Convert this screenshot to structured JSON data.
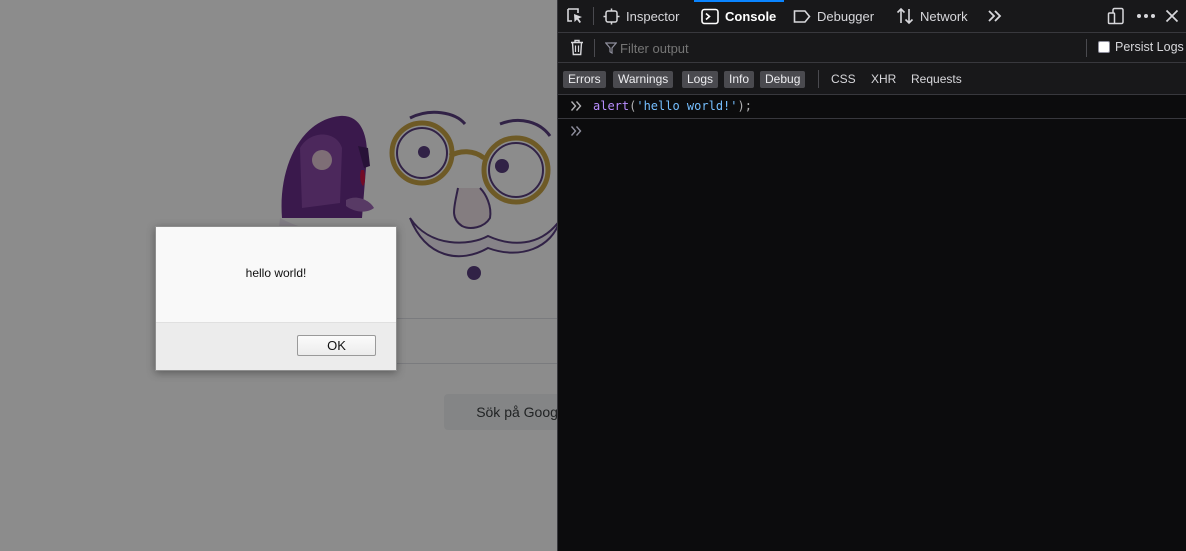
{
  "page": {
    "search_button_label": "Sök på Google"
  },
  "alert": {
    "message": "hello world!",
    "ok_label": "OK"
  },
  "devtools": {
    "tabs": [
      {
        "label": "Inspector",
        "icon": "inspector-icon"
      },
      {
        "label": "Console",
        "icon": "console-icon",
        "active": true
      },
      {
        "label": "Debugger",
        "icon": "debugger-icon"
      },
      {
        "label": "Network",
        "icon": "network-icon"
      }
    ],
    "filter_placeholder": "Filter output",
    "persist_logs_label": "Persist Logs",
    "persist_logs_checked": false,
    "level_filters": [
      "Errors",
      "Warnings",
      "Logs",
      "Info",
      "Debug"
    ],
    "extra_filters": [
      "CSS",
      "XHR",
      "Requests"
    ],
    "console_input": {
      "fn": "alert",
      "open": "(",
      "arg": "'hello world!'",
      "close": ");"
    },
    "colors": {
      "accent": "#0a84ff",
      "panel_bg": "#0c0c0d",
      "toolbar_bg": "#18181a",
      "function": "#b98eff",
      "string": "#75bfff"
    }
  }
}
